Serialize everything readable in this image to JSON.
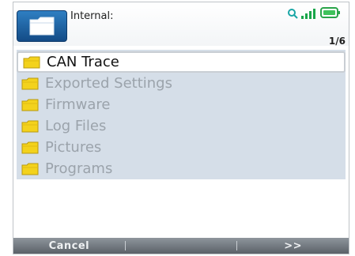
{
  "header": {
    "location": "Internal:",
    "page_indicator": "1/6"
  },
  "icons": {
    "header": "folder-icon",
    "status": [
      "search-icon",
      "signal-icon",
      "battery-icon"
    ],
    "list_item": "folder-icon"
  },
  "list": {
    "selected_index": 0,
    "items": [
      {
        "label": "CAN Trace"
      },
      {
        "label": "Exported Settings"
      },
      {
        "label": "Firmware"
      },
      {
        "label": "Log Files"
      },
      {
        "label": "Pictures"
      },
      {
        "label": "Programs"
      }
    ]
  },
  "softkeys": {
    "left": "Cancel",
    "middle": "",
    "right": ">>"
  },
  "colors": {
    "accent": "#1f64a8",
    "list_background": "#d5dee8",
    "folder": "#f3d21c",
    "battery": "#3fc25b"
  }
}
